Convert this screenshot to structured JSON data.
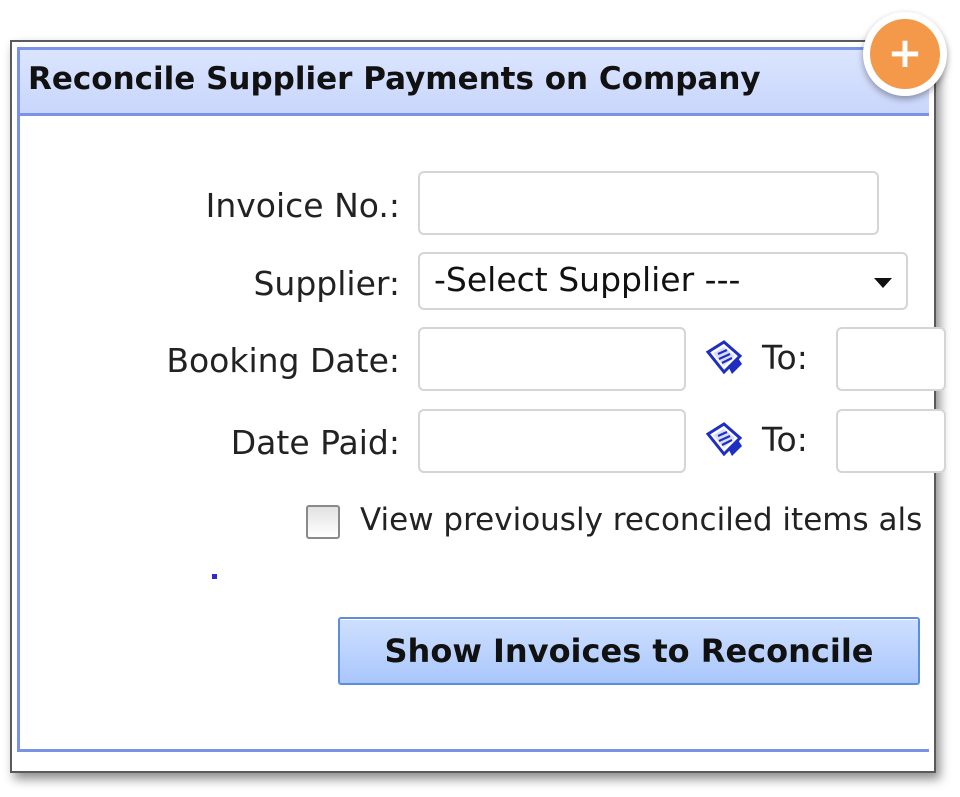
{
  "panel": {
    "title": "Reconcile Supplier Payments on Company"
  },
  "add_button": {
    "label": "+",
    "icon": "plus-icon",
    "color": "#f4994a"
  },
  "form": {
    "invoice_label": "Invoice No.:",
    "invoice_value": "",
    "supplier_label": "Supplier:",
    "supplier_selected": "-Select Supplier ---",
    "booking_date_label": "Booking Date:",
    "booking_date_from": "",
    "booking_date_to_label": "To:",
    "booking_date_to": "",
    "date_paid_label": "Date Paid:",
    "date_paid_from": "",
    "date_paid_to_label": "To:",
    "date_paid_to": "",
    "calendar_icon": "calendar-icon",
    "reconciled_checkbox_label": "View previously reconciled items als",
    "reconciled_checked": false,
    "submit_label": "Show Invoices to Reconcile"
  },
  "colors": {
    "title_bar": "#c9d6fb",
    "panel_border": "#7b93e6",
    "button_fill": "#a9c6fb"
  }
}
